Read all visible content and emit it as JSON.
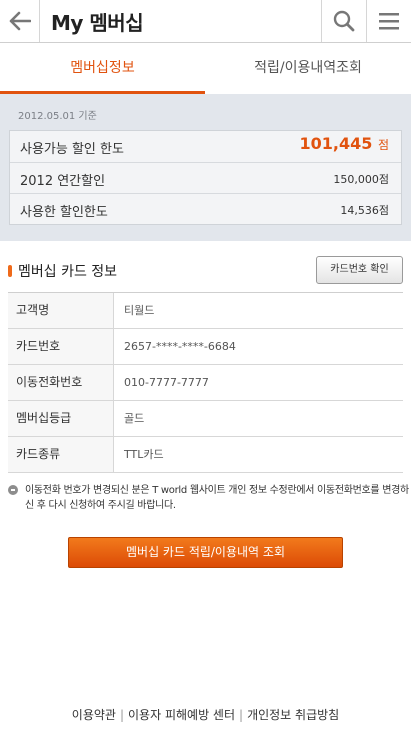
{
  "header": {
    "title": "My 멤버십",
    "back_icon": "arrow-left-icon",
    "search_icon": "search-icon",
    "menu_icon": "hamburger-menu-icon"
  },
  "tabs": [
    {
      "label": "멤버십정보",
      "active": true
    },
    {
      "label": "적립/이용내역조회",
      "active": false
    }
  ],
  "summary": {
    "date": "2012.05.01 기준",
    "rows": [
      {
        "label": "사용가능 할인 한도",
        "value": "101,445",
        "unit": "점"
      },
      {
        "label": "2012 연간할인",
        "value": "150,000점"
      },
      {
        "label": "사용한 할인한도",
        "value": "14,536점"
      }
    ]
  },
  "card_section": {
    "title": "멤버십 카드 정보",
    "confirm_button": "카드번호 확인"
  },
  "card_info": [
    {
      "label": "고객명",
      "value": "티월드"
    },
    {
      "label": "카드번호",
      "value": "2657-****-****-6684"
    },
    {
      "label": "이동전화번호",
      "value": "010-7777-7777"
    },
    {
      "label": "멤버십등급",
      "value": "골드"
    },
    {
      "label": "카드종류",
      "value": "TTL카드"
    }
  ],
  "notice": "이동전화 번호가 변경되신 분은 T world 웹사이트 개인 정보 수정란에서 이동전화번호를 변경하신 후 다시 신청하여 주시길 바랍니다.",
  "main_button": "멤버십 카드 적립/이용내역 조회",
  "footer": [
    "이용약관",
    "이용자 피해예방 센터",
    "개인정보 취급방침"
  ],
  "colors": {
    "accent": "#e1530f",
    "summary_bg": "#e2e6ec"
  }
}
